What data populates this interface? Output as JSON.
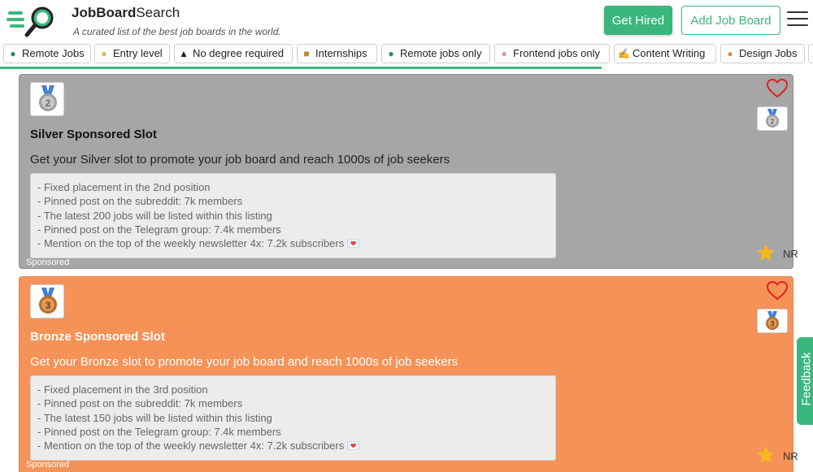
{
  "header": {
    "brand_strong": "JobBoard",
    "brand_rest": "Search",
    "tagline": "A curated list of the best job boards in the world.",
    "get_hired_label": "Get Hired",
    "add_board_label": "Add Job Board",
    "accent_color": "#3bb77e"
  },
  "chips": [
    {
      "label": "Remote Jobs",
      "icon": "globe-icon"
    },
    {
      "label": "Entry level",
      "icon": "baby-icon"
    },
    {
      "label": "No degree required",
      "icon": "graduation-cap-icon"
    },
    {
      "label": "Internships",
      "icon": "intern-icon"
    },
    {
      "label": "Remote jobs only",
      "icon": "globe-icon"
    },
    {
      "label": "Frontend jobs only",
      "icon": "frontend-icon"
    },
    {
      "label": "Content Writing",
      "icon": "writing-hand-icon"
    },
    {
      "label": "Design Jobs",
      "icon": "artist-icon"
    }
  ],
  "cards": [
    {
      "title": "Silver Sponsored Slot",
      "description": "Get your Silver slot to promote your job board and reach 1000s of job seekers",
      "medal_number": "2",
      "features": [
        "- Fixed placement in the 2nd position",
        "- Pinned post on the subreddit: 7k members",
        "- The latest 200 jobs will be listed within this listing",
        "- Pinned post on the Telegram group: 7.4k members",
        "- Mention on the top of the weekly newsletter 4x: 7.2k subscribers 💌"
      ],
      "sponsored_label": "Sponsored",
      "rating": "NR",
      "bg_color": "#a6a6a6"
    },
    {
      "title": "Bronze Sponsored Slot",
      "description": "Get your Bronze slot to promote your job board and reach 1000s of job seekers",
      "medal_number": "3",
      "features": [
        "- Fixed placement in the 3rd position",
        "- Pinned post on the subreddit: 7k members",
        "- The latest 150 jobs will be listed within this listing",
        "- Pinned post on the Telegram group: 7.4k members",
        "- Mention on the top of the weekly newsletter 4x: 7.2k subscribers 💌"
      ],
      "sponsored_label": "Sponsored",
      "rating": "NR",
      "bg_color": "#f59258"
    }
  ],
  "feedback_label": "Feedback"
}
